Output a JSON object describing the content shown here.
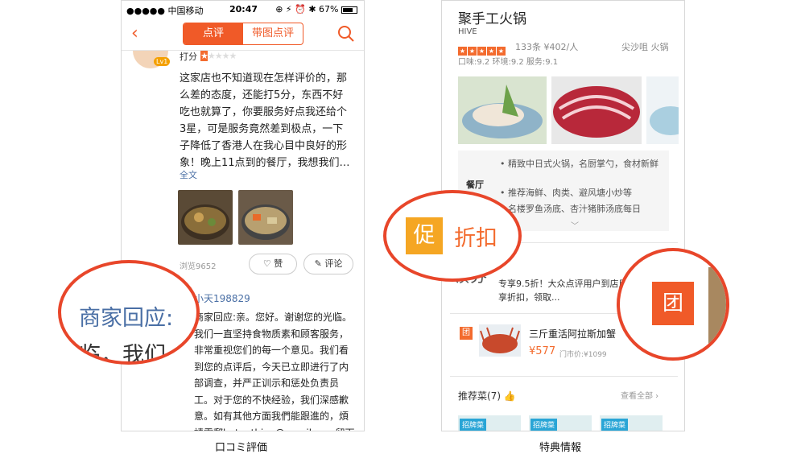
{
  "left_phone": {
    "status": {
      "carrier": "●●●●● 中国移动 ",
      "time": "20:47",
      "battery": "67%"
    },
    "nav": {
      "tab_active": "点评",
      "tab_inactive": "带图点评"
    },
    "badge": "Lv1",
    "rating_label": "打分",
    "review_text": "这家店也不知道现在怎样评价的，那么差的态度，还能打5分，东西不好吃也就算了，你要服务好点我还给个3星，可是服务竟然差到极点，一下子降低了香港人在我心目中良好的形象！晚上11点到的餐厅，我想我们…",
    "full_text_link": "全文",
    "views": "浏览9652",
    "like_label": "赞",
    "comment_label": "评论",
    "reply_name": "小天198829",
    "reply_text": "商家回应:亲。您好。谢谢您的光临。我们一直坚持食物质素和顾客服务，非常重视您们的每一个意见。我们看到您的点评后，今天已立即进行了内部调查，并严正训示和惩处负责员工。对于您的不快经验，我们深感歉意。如有其他方面我們能跟進的，煩請電郵hotpothive@gmail.com留下聯絡方法，我們會盡快回覆。再次",
    "zoom_line1": "商家回应:",
    "zoom_line2": "临，我们"
  },
  "right_phone": {
    "shop_name": "聚手工火锅",
    "shop_sub": "HIVE",
    "meta": "133条 ¥402/人",
    "location": "尖沙咀 火锅",
    "scores": "口味:9.2 环境:9.2 服务:9.1",
    "feature_label": "餐厅",
    "features": [
      "精致中日式火锅，名厨掌勺，食材新鲜",
      "推荐海鲜、肉类、避风塘小炒等",
      "名楼罗鱼汤底、杏汁猪肺汤底每日"
    ],
    "promo_heading": "领券",
    "promo_text": "专享9.5折！大众点评用户到店用餐专享折扣，领取...",
    "deal_tag": "团",
    "deal_title": "三斤重活阿拉斯加蟹",
    "deal_price": "¥577",
    "deal_original": "门市价:¥1099",
    "rec_title": "推荐菜(7)",
    "rec_all": "查看全部",
    "rec_tag": "招牌菜",
    "zoom_cu": "促",
    "zoom_discount": "折扣",
    "zoom_tuan": "团"
  },
  "captions": {
    "left": "口コミ評価",
    "right": "特典情報"
  },
  "colors": {
    "accent": "#f05a28",
    "link": "#4a6fa5",
    "highlight_circle": "#e8462a"
  }
}
